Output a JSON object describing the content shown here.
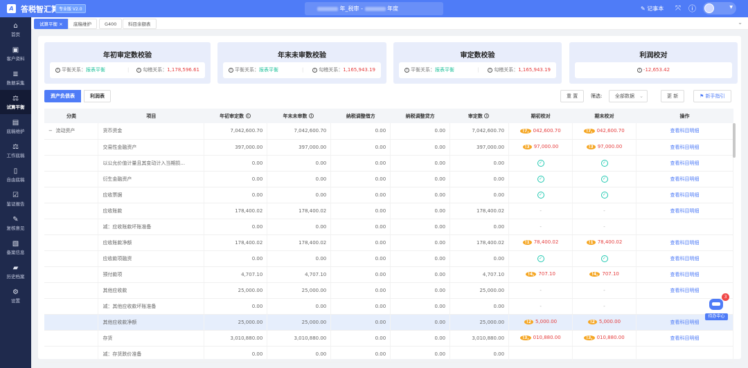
{
  "app": {
    "name": "答税智汇算",
    "version": "专业版 V2.0",
    "doc_title_parts": [
      "年_税审 -",
      "年度"
    ],
    "notebook": "记事本"
  },
  "sidebar": [
    {
      "icon": "home-icon",
      "g": "⌂",
      "label": "首页"
    },
    {
      "icon": "id-card-icon",
      "g": "▣",
      "label": "客户资料"
    },
    {
      "icon": "database-icon",
      "g": "≣",
      "label": "数据采集"
    },
    {
      "icon": "scale-icon",
      "g": "⚖",
      "label": "试算平衡",
      "active": true
    },
    {
      "icon": "document-icon",
      "g": "▤",
      "label": "底稿维护"
    },
    {
      "icon": "scale-icon",
      "g": "⚖",
      "label": "工作底稿"
    },
    {
      "icon": "notebook-icon",
      "g": "▯",
      "label": "自由底稿"
    },
    {
      "icon": "report-icon",
      "g": "☑",
      "label": "鉴证报告"
    },
    {
      "icon": "review-icon",
      "g": "✎",
      "label": "复核意见"
    },
    {
      "icon": "archive-icon",
      "g": "▧",
      "label": "备案信息"
    },
    {
      "icon": "folder-icon",
      "g": "▰",
      "label": "历史档案"
    },
    {
      "icon": "gear-icon",
      "g": "⚙",
      "label": "设置"
    }
  ],
  "tabs": [
    "试算平衡",
    "底稿维护",
    "G400",
    "科目余额表"
  ],
  "cards": [
    {
      "title": "年初审定数校验",
      "balance_label": "平衡关系：",
      "balance": "报表平衡",
      "check_label": "勾稽关系：",
      "check": "1,178,596.61"
    },
    {
      "title": "年末未审数校验",
      "balance_label": "平衡关系：",
      "balance": "报表平衡",
      "check_label": "勾稽关系：",
      "check": "1,165,943.19"
    },
    {
      "title": "审定数校验",
      "balance_label": "平衡关系：",
      "balance": "报表平衡",
      "check_label": "勾稽关系：",
      "check": "1,165,943.19"
    },
    {
      "title": "利润校对",
      "value": "-12,653.42"
    }
  ],
  "toolbar": {
    "seg": [
      "资产负债表",
      "利润表"
    ],
    "reset": "重 置",
    "filter_label": "筛选:",
    "filter_value": "全部数据",
    "refresh": "更 新",
    "guide": "新手指引"
  },
  "table": {
    "headers": [
      "分类",
      "项目",
      "年初审定数",
      "年末未审数",
      "纳税调整借方",
      "纳税调整贷方",
      "审定数",
      "期初校对",
      "期末校对",
      "操作"
    ],
    "rows": [
      [
        "流动资产",
        "货币资金",
        "7,042,600.70",
        "7,042,600.70",
        "0.00",
        "0.00",
        "7,042,600.70",
        "!7,042,600.70",
        "!7,042,600.70",
        "查看科目明细"
      ],
      [
        "",
        "交易性金融资产",
        "397,000.00",
        "397,000.00",
        "0.00",
        "0.00",
        "397,000.00",
        "!397,000.00",
        "!397,000.00",
        "查看科目明细"
      ],
      [
        "",
        "以公允价值计量且其变动计入当期损...",
        "0.00",
        "0.00",
        "0.00",
        "0.00",
        "0.00",
        "ok",
        "ok",
        "查看科目明细"
      ],
      [
        "",
        "衍生金融资产",
        "0.00",
        "0.00",
        "0.00",
        "0.00",
        "0.00",
        "ok",
        "ok",
        "查看科目明细"
      ],
      [
        "",
        "应收票据",
        "0.00",
        "0.00",
        "0.00",
        "0.00",
        "0.00",
        "ok",
        "ok",
        "查看科目明细"
      ],
      [
        "",
        "应收账款",
        "178,400.02",
        "178,400.02",
        "0.00",
        "0.00",
        "178,400.02",
        "-",
        "-",
        "查看科目明细"
      ],
      [
        "",
        "减：应收账款坏账准备",
        "0.00",
        "0.00",
        "0.00",
        "0.00",
        "0.00",
        "-",
        "-",
        ""
      ],
      [
        "",
        "应收账款净额",
        "178,400.02",
        "178,400.02",
        "0.00",
        "0.00",
        "178,400.02",
        "!178,400.02",
        "!178,400.02",
        "查看科目明细"
      ],
      [
        "",
        "应收款项融资",
        "0.00",
        "0.00",
        "0.00",
        "0.00",
        "0.00",
        "ok",
        "ok",
        "查看科目明细"
      ],
      [
        "",
        "预付款项",
        "4,707.10",
        "4,707.10",
        "0.00",
        "0.00",
        "4,707.10",
        "!4,707.10",
        "!4,707.10",
        "查看科目明细"
      ],
      [
        "",
        "其他应收款",
        "25,000.00",
        "25,000.00",
        "0.00",
        "0.00",
        "25,000.00",
        "-",
        "-",
        "查看科目明细"
      ],
      [
        "",
        "减：其他应收款坏账准备",
        "0.00",
        "0.00",
        "0.00",
        "0.00",
        "0.00",
        "-",
        "-",
        ""
      ],
      [
        "",
        "其他应收款净额",
        "25,000.00",
        "25,000.00",
        "0.00",
        "0.00",
        "25,000.00",
        "!25,000.00",
        "!25,000.00",
        "查看科目明细"
      ],
      [
        "",
        "存货",
        "3,010,880.00",
        "3,010,880.00",
        "0.00",
        "0.00",
        "3,010,880.00",
        "!3,010,880.00",
        "!3,010,880.00",
        "查看科目明细"
      ],
      [
        "",
        "减：存货跌价准备",
        "0.00",
        "0.00",
        "0.00",
        "0.00",
        "0.00",
        "",
        "",
        ""
      ]
    ],
    "highlighted_row": 12
  },
  "todo": {
    "label": "待办中心",
    "badge": "3"
  },
  "colors": {
    "primary": "#4f7cf7",
    "sidebar": "#1f2a4d",
    "ok": "#1fc19a",
    "error": "#e53c3c",
    "warn": "#f5a623"
  }
}
